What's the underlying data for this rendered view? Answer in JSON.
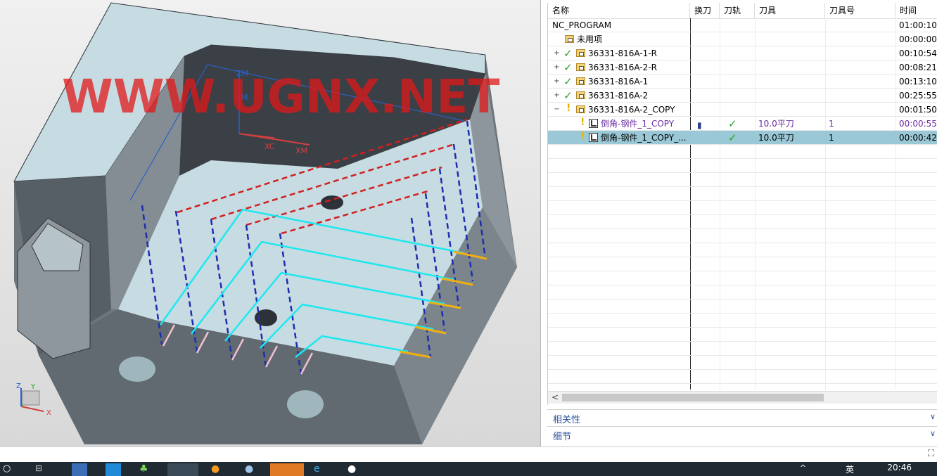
{
  "viewport": {
    "watermark": "WWW.UGNX.NET",
    "csys_labels": {
      "zm": "ZM",
      "ym": "YM",
      "xc": "XC",
      "xm": "XM"
    },
    "triad_labels": {
      "z": "Z",
      "y": "Y",
      "x": "X"
    }
  },
  "navigator": {
    "columns": [
      "名称",
      "换刀",
      "刀轨",
      "刀具",
      "刀具号",
      "时间"
    ],
    "rows": [
      {
        "name": "NC_PROGRAM",
        "time": "01:00:10",
        "type": "root"
      },
      {
        "name": "未用项",
        "time": "00:00:00",
        "type": "folder"
      },
      {
        "name": "36331-816A-1-R",
        "time": "00:10:54",
        "type": "program",
        "status": "ok"
      },
      {
        "name": "36331-816A-2-R",
        "time": "00:08:21",
        "type": "program",
        "status": "ok"
      },
      {
        "name": "36331-816A-1",
        "time": "00:13:10",
        "type": "program",
        "status": "ok"
      },
      {
        "name": "36331-816A-2",
        "time": "00:25:55",
        "type": "program",
        "status": "ok"
      },
      {
        "name": "36331-816A-2_COPY",
        "time": "00:01:50",
        "type": "program",
        "status": "warn"
      },
      {
        "name": "倒角-钢件_1_COPY",
        "tool": "10.0平刀",
        "tool_no": "1",
        "time": "00:00:55",
        "type": "operation",
        "status": "warn",
        "purple": true
      },
      {
        "name": "倒角-钢件_1_COPY_...",
        "tool": "10.0平刀",
        "tool_no": "1",
        "time": "00:00:42",
        "type": "operation",
        "status": "warn",
        "selected": true
      }
    ],
    "scroll_left": "<"
  },
  "panels": {
    "dependencies": "相关性",
    "details": "细节",
    "chevron": "∨"
  },
  "taskbar": {
    "clock": "20:46",
    "ime": "英",
    "tray": "^"
  }
}
